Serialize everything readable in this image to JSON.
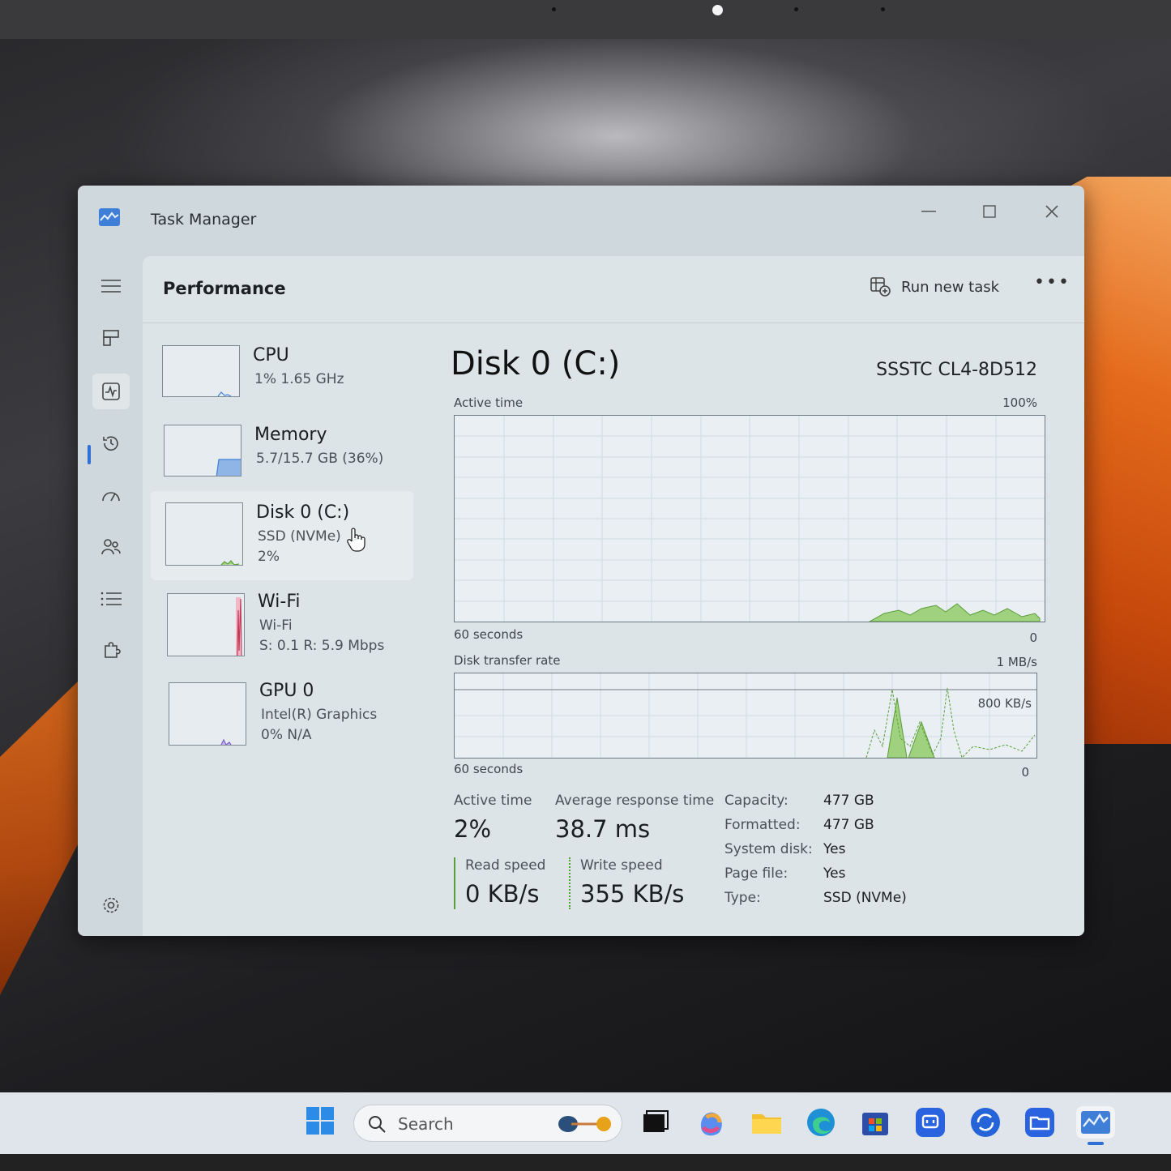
{
  "window": {
    "title": "Task Manager"
  },
  "header": {
    "page_title": "Performance",
    "run_new_task": "Run new task",
    "more": "•••"
  },
  "resources": [
    {
      "name": "CPU",
      "sub1": "1%  1.65 GHz",
      "sub2": ""
    },
    {
      "name": "Memory",
      "sub1": "5.7/15.7 GB (36%)",
      "sub2": ""
    },
    {
      "name": "Disk 0 (C:)",
      "sub1": "SSD (NVMe)",
      "sub2": "2%"
    },
    {
      "name": "Wi-Fi",
      "sub1": "Wi-Fi",
      "sub2": "S: 0.1  R: 5.9 Mbps"
    },
    {
      "name": "GPU 0",
      "sub1": "Intel(R) Graphics",
      "sub2": "0%  N/A"
    }
  ],
  "detail": {
    "title": "Disk 0 (C:)",
    "model": "SSSTC CL4-8D512",
    "active_graph": {
      "label": "Active time",
      "max": "100%",
      "time": "60 seconds",
      "min": "0"
    },
    "transfer_graph": {
      "label": "Disk transfer rate",
      "max": "1 MB/s",
      "mid": "800 KB/s",
      "time": "60 seconds",
      "min": "0"
    },
    "stats": {
      "active_time_label": "Active time",
      "active_time_value": "2%",
      "avg_response_label": "Average response time",
      "avg_response_value": "38.7 ms",
      "read_label": "Read speed",
      "read_value": "0 KB/s",
      "write_label": "Write speed",
      "write_value": "355 KB/s"
    },
    "props": [
      {
        "k": "Capacity:",
        "v": "477 GB"
      },
      {
        "k": "Formatted:",
        "v": "477 GB"
      },
      {
        "k": "System disk:",
        "v": "Yes"
      },
      {
        "k": "Page file:",
        "v": "Yes"
      },
      {
        "k": "Type:",
        "v": "SSD (NVMe)"
      }
    ]
  },
  "taskbar": {
    "search_placeholder": "Search"
  },
  "colors": {
    "accent": "#2f6fd6",
    "disk_green": "#7cbf5a",
    "graph_bg": "#e9eff2"
  }
}
